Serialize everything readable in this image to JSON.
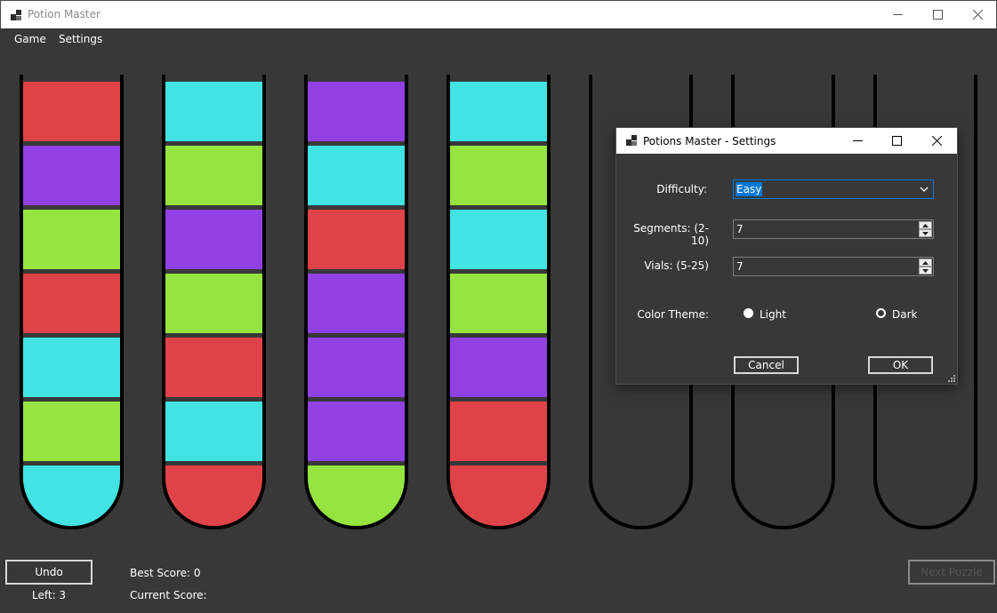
{
  "window": {
    "title": "Potion Master",
    "icon": "app-logo-icon",
    "controls": [
      "minimize-icon",
      "maximize-icon",
      "close-icon"
    ]
  },
  "menu": [
    "Game",
    "Settings"
  ],
  "colors": {
    "red": "#e04347",
    "purple": "#9141e3",
    "green": "#95e43f",
    "cyan": "#42e3e3",
    "background": "#383838"
  },
  "vials": [
    [
      "red",
      "purple",
      "green",
      "red",
      "cyan",
      "green",
      "cyan"
    ],
    [
      "cyan",
      "green",
      "purple",
      "green",
      "red",
      "cyan",
      "red"
    ],
    [
      "purple",
      "cyan",
      "red",
      "purple",
      "purple",
      "purple",
      "green"
    ],
    [
      "cyan",
      "green",
      "cyan",
      "green",
      "purple",
      "red",
      "red"
    ],
    [],
    [],
    []
  ],
  "footer": {
    "undo_label": "Undo",
    "left_text": "Left: 3",
    "best_score_text": "Best Score: 0",
    "current_score_text": "Current Score:",
    "next_puzzle_label": "Next Puzzle"
  },
  "settings_dialog": {
    "title": "Potions Master - Settings",
    "difficulty_label": "Difficulty:",
    "difficulty_value": "Easy",
    "segments_label": "Segments: (2-10)",
    "segments_value": "7",
    "vials_label": "Vials: (5-25)",
    "vials_value": "7",
    "theme_label": "Color Theme:",
    "theme_light": "Light",
    "theme_dark": "Dark",
    "theme_selected": "Light",
    "cancel_label": "Cancel",
    "ok_label": "OK"
  }
}
